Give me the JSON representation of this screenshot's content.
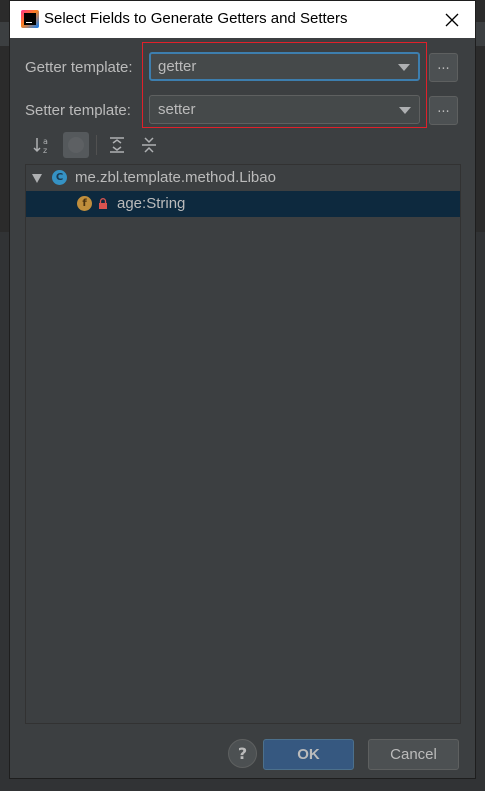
{
  "dialog": {
    "title": "Select Fields to Generate Getters and Setters"
  },
  "getter": {
    "label": "Getter template:",
    "value": "getter",
    "more": "..."
  },
  "setter": {
    "label": "Setter template:",
    "value": "setter",
    "more": "..."
  },
  "toolbar": {
    "items": [
      "sort-alphabetically-icon",
      "show-classes-icon",
      "expand-all-icon",
      "collapse-all-icon"
    ]
  },
  "tree": {
    "class_item": {
      "badge": "C",
      "label": "me.zbl.template.method.Libao"
    },
    "field_item": {
      "badge": "f",
      "label": "age:String"
    }
  },
  "footer": {
    "help": "?",
    "ok": "OK",
    "cancel": "Cancel"
  },
  "colors": {
    "dialog_bg": "#3c3f41",
    "selection": "#0d293e",
    "focus_border": "#3d7eae",
    "ok_button": "#365880",
    "annotation": "#e0202a"
  }
}
